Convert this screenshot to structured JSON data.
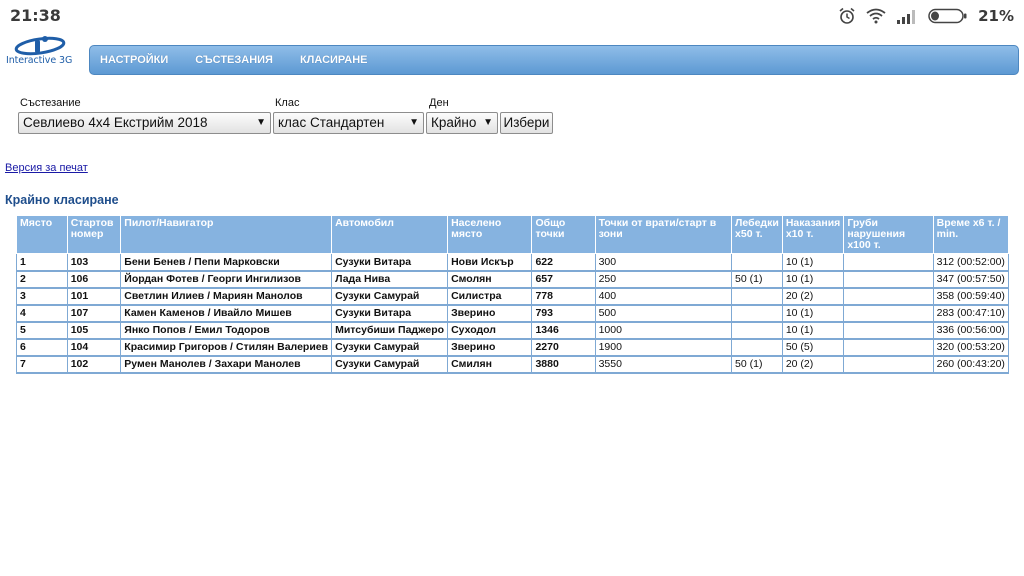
{
  "statusbar": {
    "time": "21:38",
    "battery_pct": "21%"
  },
  "logo": {
    "text": "Interactive 3G"
  },
  "nav": [
    {
      "label": "НАСТРОЙКИ"
    },
    {
      "label": "СЪСТЕЗАНИЯ"
    },
    {
      "label": "КЛАСИРАНЕ"
    }
  ],
  "filters": {
    "competition": {
      "label": "Състезание",
      "value": "Севлиево 4x4 Екстрийм 2018"
    },
    "class": {
      "label": "Клас",
      "value": "клас Стандартен"
    },
    "day": {
      "label": "Ден",
      "value": "Крайно"
    },
    "submit_label": "Избери"
  },
  "print_link": "Версия за печат",
  "section_title": "Крайно класиране",
  "table": {
    "headers": [
      "Място",
      "Стартов номер",
      "Пилот/Навигатор",
      "Автомобил",
      "Населено място",
      "Общо точки",
      "Точки от врати/старт в зони",
      "Лебедки x50 т.",
      "Наказания x10 т.",
      "Груби нарушения x100 т.",
      "Време x6 т. / min."
    ],
    "rows": [
      [
        "1",
        "103",
        "Бени Бенев / Пепи Марковски",
        "Сузуки Витара",
        "Нови Искър",
        "622",
        "300",
        "",
        "10 (1)",
        "",
        "312 (00:52:00)"
      ],
      [
        "2",
        "106",
        "Йордан Фотев / Георги Ингилизов",
        "Лада Нива",
        "Смолян",
        "657",
        "250",
        "50 (1)",
        "10 (1)",
        "",
        "347 (00:57:50)"
      ],
      [
        "3",
        "101",
        "Светлин Илиев / Мариян Манолов",
        "Сузуки Самурай",
        "Силистра",
        "778",
        "400",
        "",
        "20 (2)",
        "",
        "358 (00:59:40)"
      ],
      [
        "4",
        "107",
        "Камен Каменов / Ивайло Мишев",
        "Сузуки Витара",
        "Зверино",
        "793",
        "500",
        "",
        "10 (1)",
        "",
        "283 (00:47:10)"
      ],
      [
        "5",
        "105",
        "Янко Попов / Емил Тодоров",
        "Митсубиши Паджеро",
        "Суходол",
        "1346",
        "1000",
        "",
        "10 (1)",
        "",
        "336 (00:56:00)"
      ],
      [
        "6",
        "104",
        "Красимир Григоров / Стилян Валериев",
        "Сузуки Самурай",
        "Зверино",
        "2270",
        "1900",
        "",
        "50 (5)",
        "",
        "320 (00:53:20)"
      ],
      [
        "7",
        "102",
        "Румен Манолев / Захари Манолев",
        "Сузуки Самурай",
        "Смилян",
        "3880",
        "3550",
        "50 (1)",
        "20 (2)",
        "",
        "260 (00:43:20)"
      ]
    ]
  }
}
